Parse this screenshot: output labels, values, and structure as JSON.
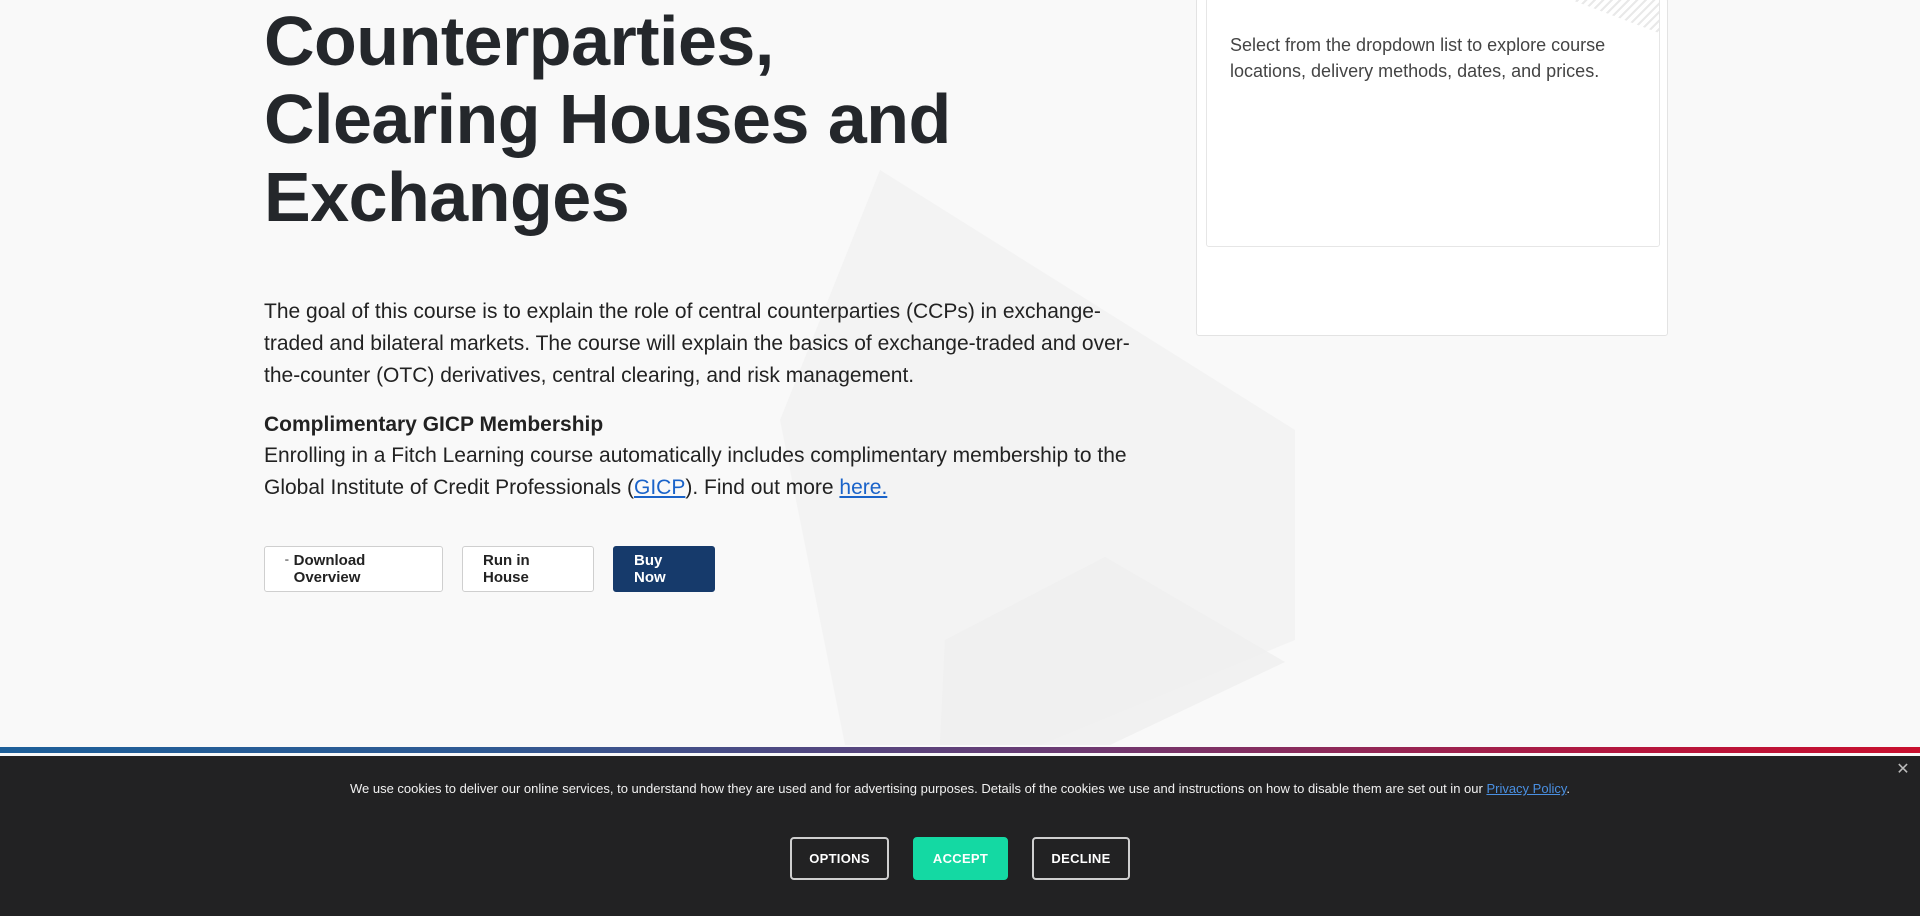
{
  "hero": {
    "title_lines": [
      "Counterparties,",
      "Clearing Houses and",
      "Exchanges"
    ]
  },
  "intro": {
    "text": "The goal of this course is to explain the role of central counterparties (CCPs) in exchange-traded and bilateral markets. The course will explain the basics of exchange-traded and over-the-counter (OTC) derivatives, central clearing, and risk management."
  },
  "membership": {
    "title": "Complimentary GICP Membership",
    "text_before": "Enrolling in a Fitch Learning course automatically includes complimentary membership to the Global Institute of Credit Professionals (",
    "gicp_link": "GICP",
    "text_middle": "). Find out more ",
    "here_link": "here."
  },
  "buttons": {
    "download_icon": "download-icon",
    "download_glyph": "ˉ",
    "download_label": "Download Overview",
    "inhouse_label": "Run in House",
    "buy_label": "Buy Now"
  },
  "side_panel": {
    "text": "Select from the dropdown list to explore course locations, delivery methods, dates, and prices."
  },
  "cookie": {
    "text_before": "We use cookies to deliver our online services, to understand how they are used and for advertising purposes. Details of the cookies we use and instructions on how to disable them are set out in our ",
    "policy_link": "Privacy Policy",
    "text_after": ".",
    "close_glyph": "✕",
    "options_label": "OPTIONS",
    "accept_label": "ACCEPT",
    "decline_label": "DECLINE"
  },
  "colors": {
    "primary_button": "#163a6b",
    "accept_button": "#14d9a3",
    "link": "#1a63c9",
    "cookie_bg": "#222223"
  }
}
